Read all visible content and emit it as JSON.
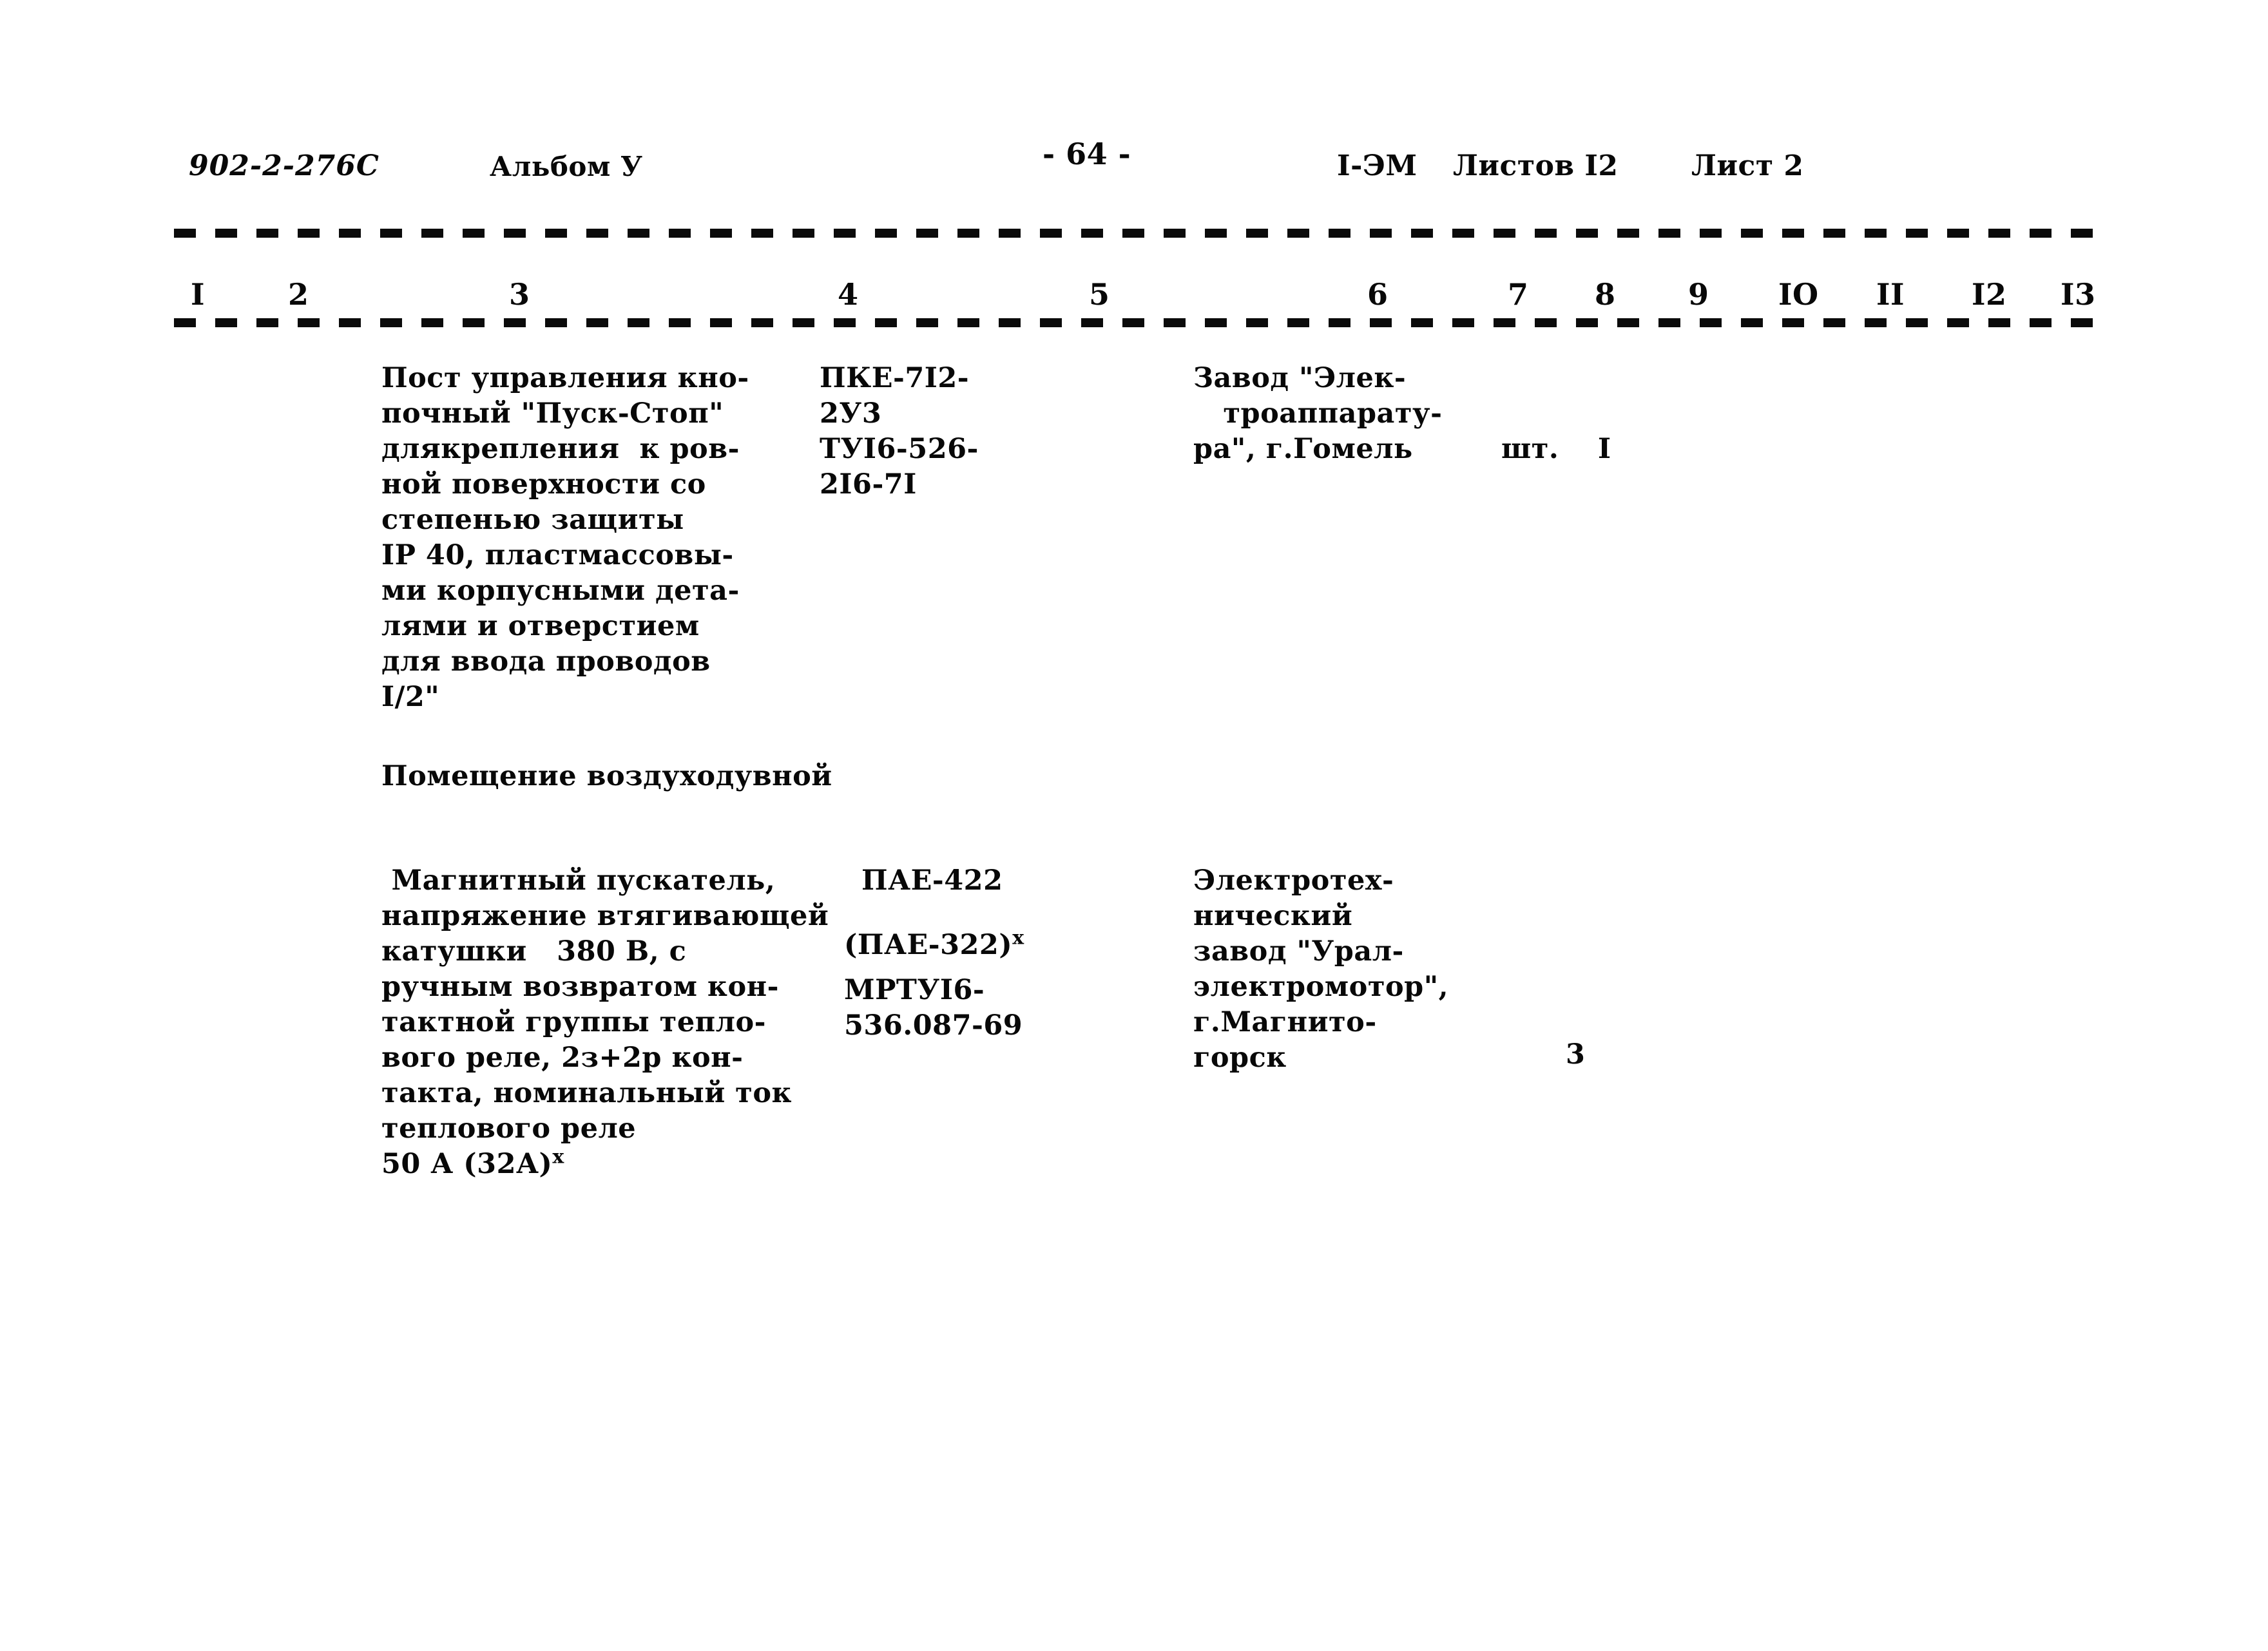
{
  "header": {
    "doc_code": "902-2-276С",
    "album": "Альбом У",
    "page_number": "- 64 -",
    "sheet_code": "I-ЭМ",
    "sheets_total": "Листов I2",
    "sheet_no": "Лист 2"
  },
  "columns": [
    "I",
    "2",
    "3",
    "4",
    "5",
    "6",
    "7",
    "8",
    "9",
    "IO",
    "II",
    "I2",
    "I3"
  ],
  "rows": [
    {
      "description": "Пост управления кно-\nпочный \"Пуск-Стоп\"\nдлякрепления  к ров-\nной поверхности со\nстепенью защиты\nIP 40, пластмассовы-\nми корпусными дета-\nлями и отверстием\nдля ввода проводов\nI/2\"",
      "type": "ПКЕ-7I2-\n2У3\nТУI6-526-\n2I6-7I",
      "manufacturer": "Завод \"Элек-\n   троаппарату-\nра\", г.Гомель",
      "unit": "шт.",
      "quantity": "I"
    },
    {
      "description": " Магнитный пускатель,\nнапряжение втягивающей\nкатушки   380 В, с\nручным возвратом кон-\nтактной группы тепло-\nвого реле, 2з+2р кон-\nтакта, номинальный ток\nтеплового реле",
      "description_last": "50 А (32А)",
      "description_last_mark": "х",
      "type_line1": "ПАЕ-422",
      "type_line2": "(ПАЕ-322)",
      "type_line2_mark": "х",
      "type_rest": "МРТУI6-\n536.087-69",
      "manufacturer": "Электротех-\nнический\nзавод \"Урал-\nэлектромотор\",\nг.Магнито-\nгорск",
      "unit": "",
      "quantity": "3"
    }
  ],
  "section_heading": "Помещение воздуходувной"
}
